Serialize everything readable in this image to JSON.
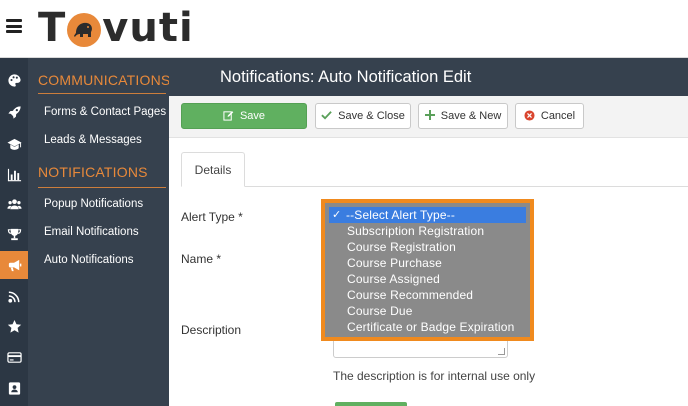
{
  "header": {
    "logo_text_before": "T",
    "logo_text_after": "vuti",
    "accent": "#e8893a"
  },
  "icon_rail": {
    "icons": [
      "palette-icon",
      "rocket-icon",
      "graduation-cap-icon",
      "bar-chart-icon",
      "users-icon",
      "trophy-icon",
      "megaphone-icon",
      "signal-icon",
      "star-icon",
      "credit-card-icon",
      "contact-card-icon"
    ],
    "active": "megaphone-icon"
  },
  "subnav": {
    "communications_title": "COMMUNICATIONS",
    "communications_items": [
      "Forms & Contact Pages",
      "Leads & Messages"
    ],
    "notifications_title": "NOTIFICATIONS",
    "notifications_items": [
      "Popup Notifications",
      "Email Notifications",
      "Auto Notifications"
    ]
  },
  "page": {
    "title": "Notifications: Auto Notification Edit"
  },
  "toolbar": {
    "save_label": "Save",
    "save_close_label": "Save & Close",
    "save_new_label": "Save & New",
    "cancel_label": "Cancel"
  },
  "tabs": {
    "details_label": "Details"
  },
  "form": {
    "alert_type_label": "Alert Type *",
    "name_label": "Name *",
    "description_label": "Description",
    "description_help": "The description is for internal use only"
  },
  "alert_type_dropdown": {
    "selected": "--Select Alert Type--",
    "options": [
      "--Select Alert Type--",
      "Subscription Registration",
      "Course Registration",
      "Course Purchase",
      "Course Assigned",
      "Course Recommended",
      "Course Due",
      "Certificate or Badge Expiration"
    ]
  }
}
